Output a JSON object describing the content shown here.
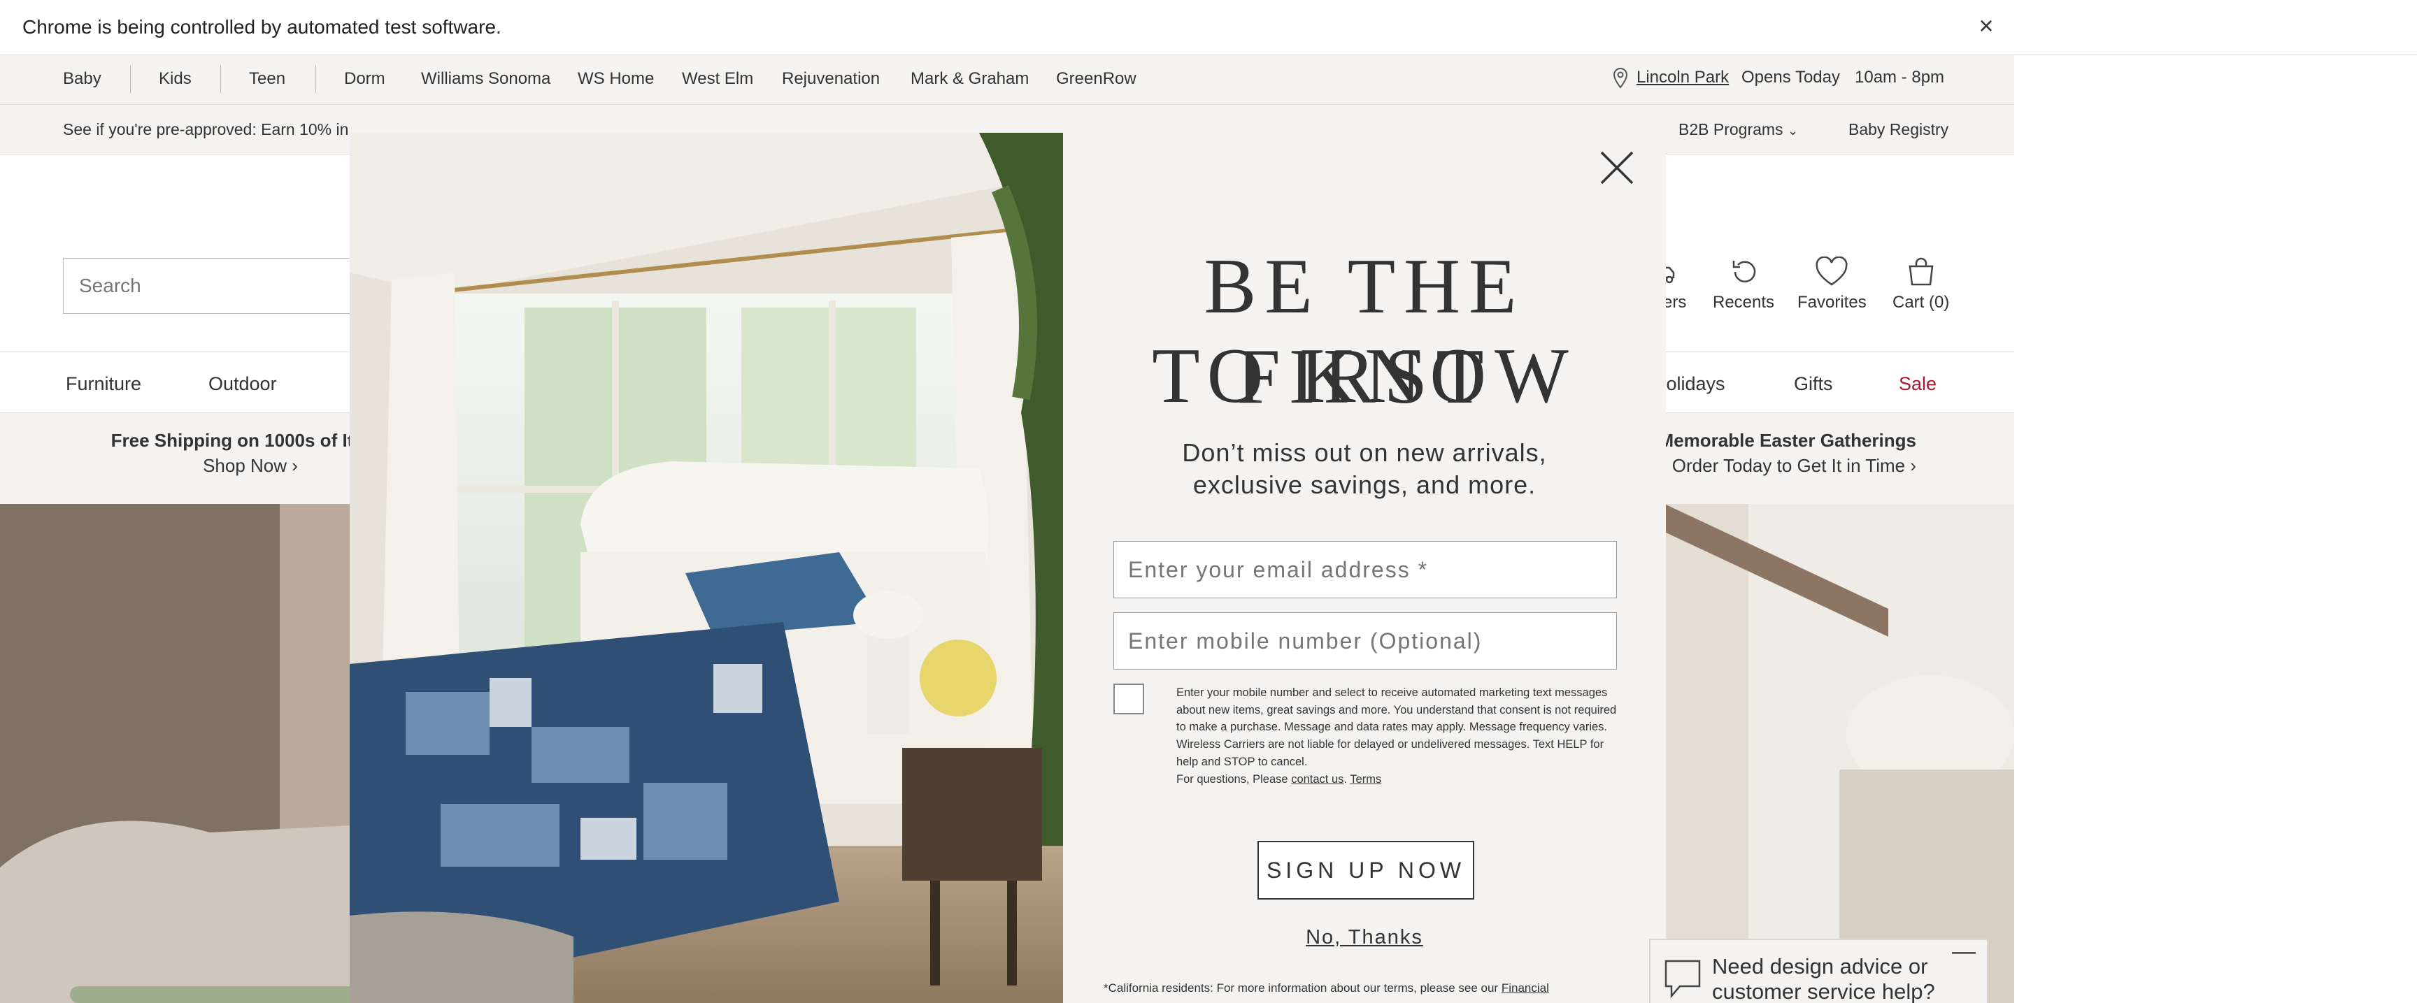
{
  "automation_bar": {
    "text": "Chrome is being controlled by automated test software.",
    "close": "×"
  },
  "brand_bar": {
    "items": [
      "Baby",
      "Kids",
      "Teen",
      "Dorm",
      "Williams Sonoma",
      "WS Home",
      "West Elm",
      "Rejuvenation",
      "Mark & Graham",
      "GreenRow"
    ],
    "store_name": "Lincoln Park",
    "store_status": "Opens Today",
    "store_hours": "10am - 8pm"
  },
  "promo_bar": {
    "financing": "See if you're pre-approved: Earn 10% in",
    "b2b": "B2B Programs",
    "baby_registry": "Baby Registry"
  },
  "header": {
    "search_placeholder": "Search",
    "orders": "Orders",
    "recents": "Recents",
    "favorites": "Favorites",
    "cart": "Cart (0)"
  },
  "category_nav": [
    "Furniture",
    "Outdoor",
    "Holidays",
    "Gifts",
    "Sale"
  ],
  "banners": {
    "left_title": "Free Shipping on 1000s of Items",
    "left_link": "Shop Now ›",
    "right_title": "Memorable Easter Gatherings",
    "right_link": "Order Today to Get It in Time ›"
  },
  "modal": {
    "headline_line1": "BE THE FIRST",
    "headline_line2": "TO KNOW",
    "sub_line1": "Don’t miss out on new arrivals,",
    "sub_line2": "exclusive savings, and more.",
    "email_placeholder": "Enter your email address *",
    "mobile_placeholder": "Enter mobile number (Optional)",
    "consent_text": "Enter your mobile number and select to receive automated marketing text messages about new items, great savings and more. You understand that consent is not required to make a purchase. Message and data rates may apply. Message frequency varies. Wireless Carriers are not liable for delayed or undelivered messages. Text HELP for help and STOP to cancel.",
    "consent_questions": "For questions, Please",
    "contact_link": "contact us",
    "terms_link": "Terms",
    "signup_button": "SIGN UP NOW",
    "no_thanks": "No, Thanks",
    "legal_text": "*California residents: For more information about our terms, please see our",
    "legal_link": "Financial"
  },
  "chat": {
    "text_line1": "Need design advice or",
    "text_line2": "customer service help?",
    "minimize": "—"
  }
}
